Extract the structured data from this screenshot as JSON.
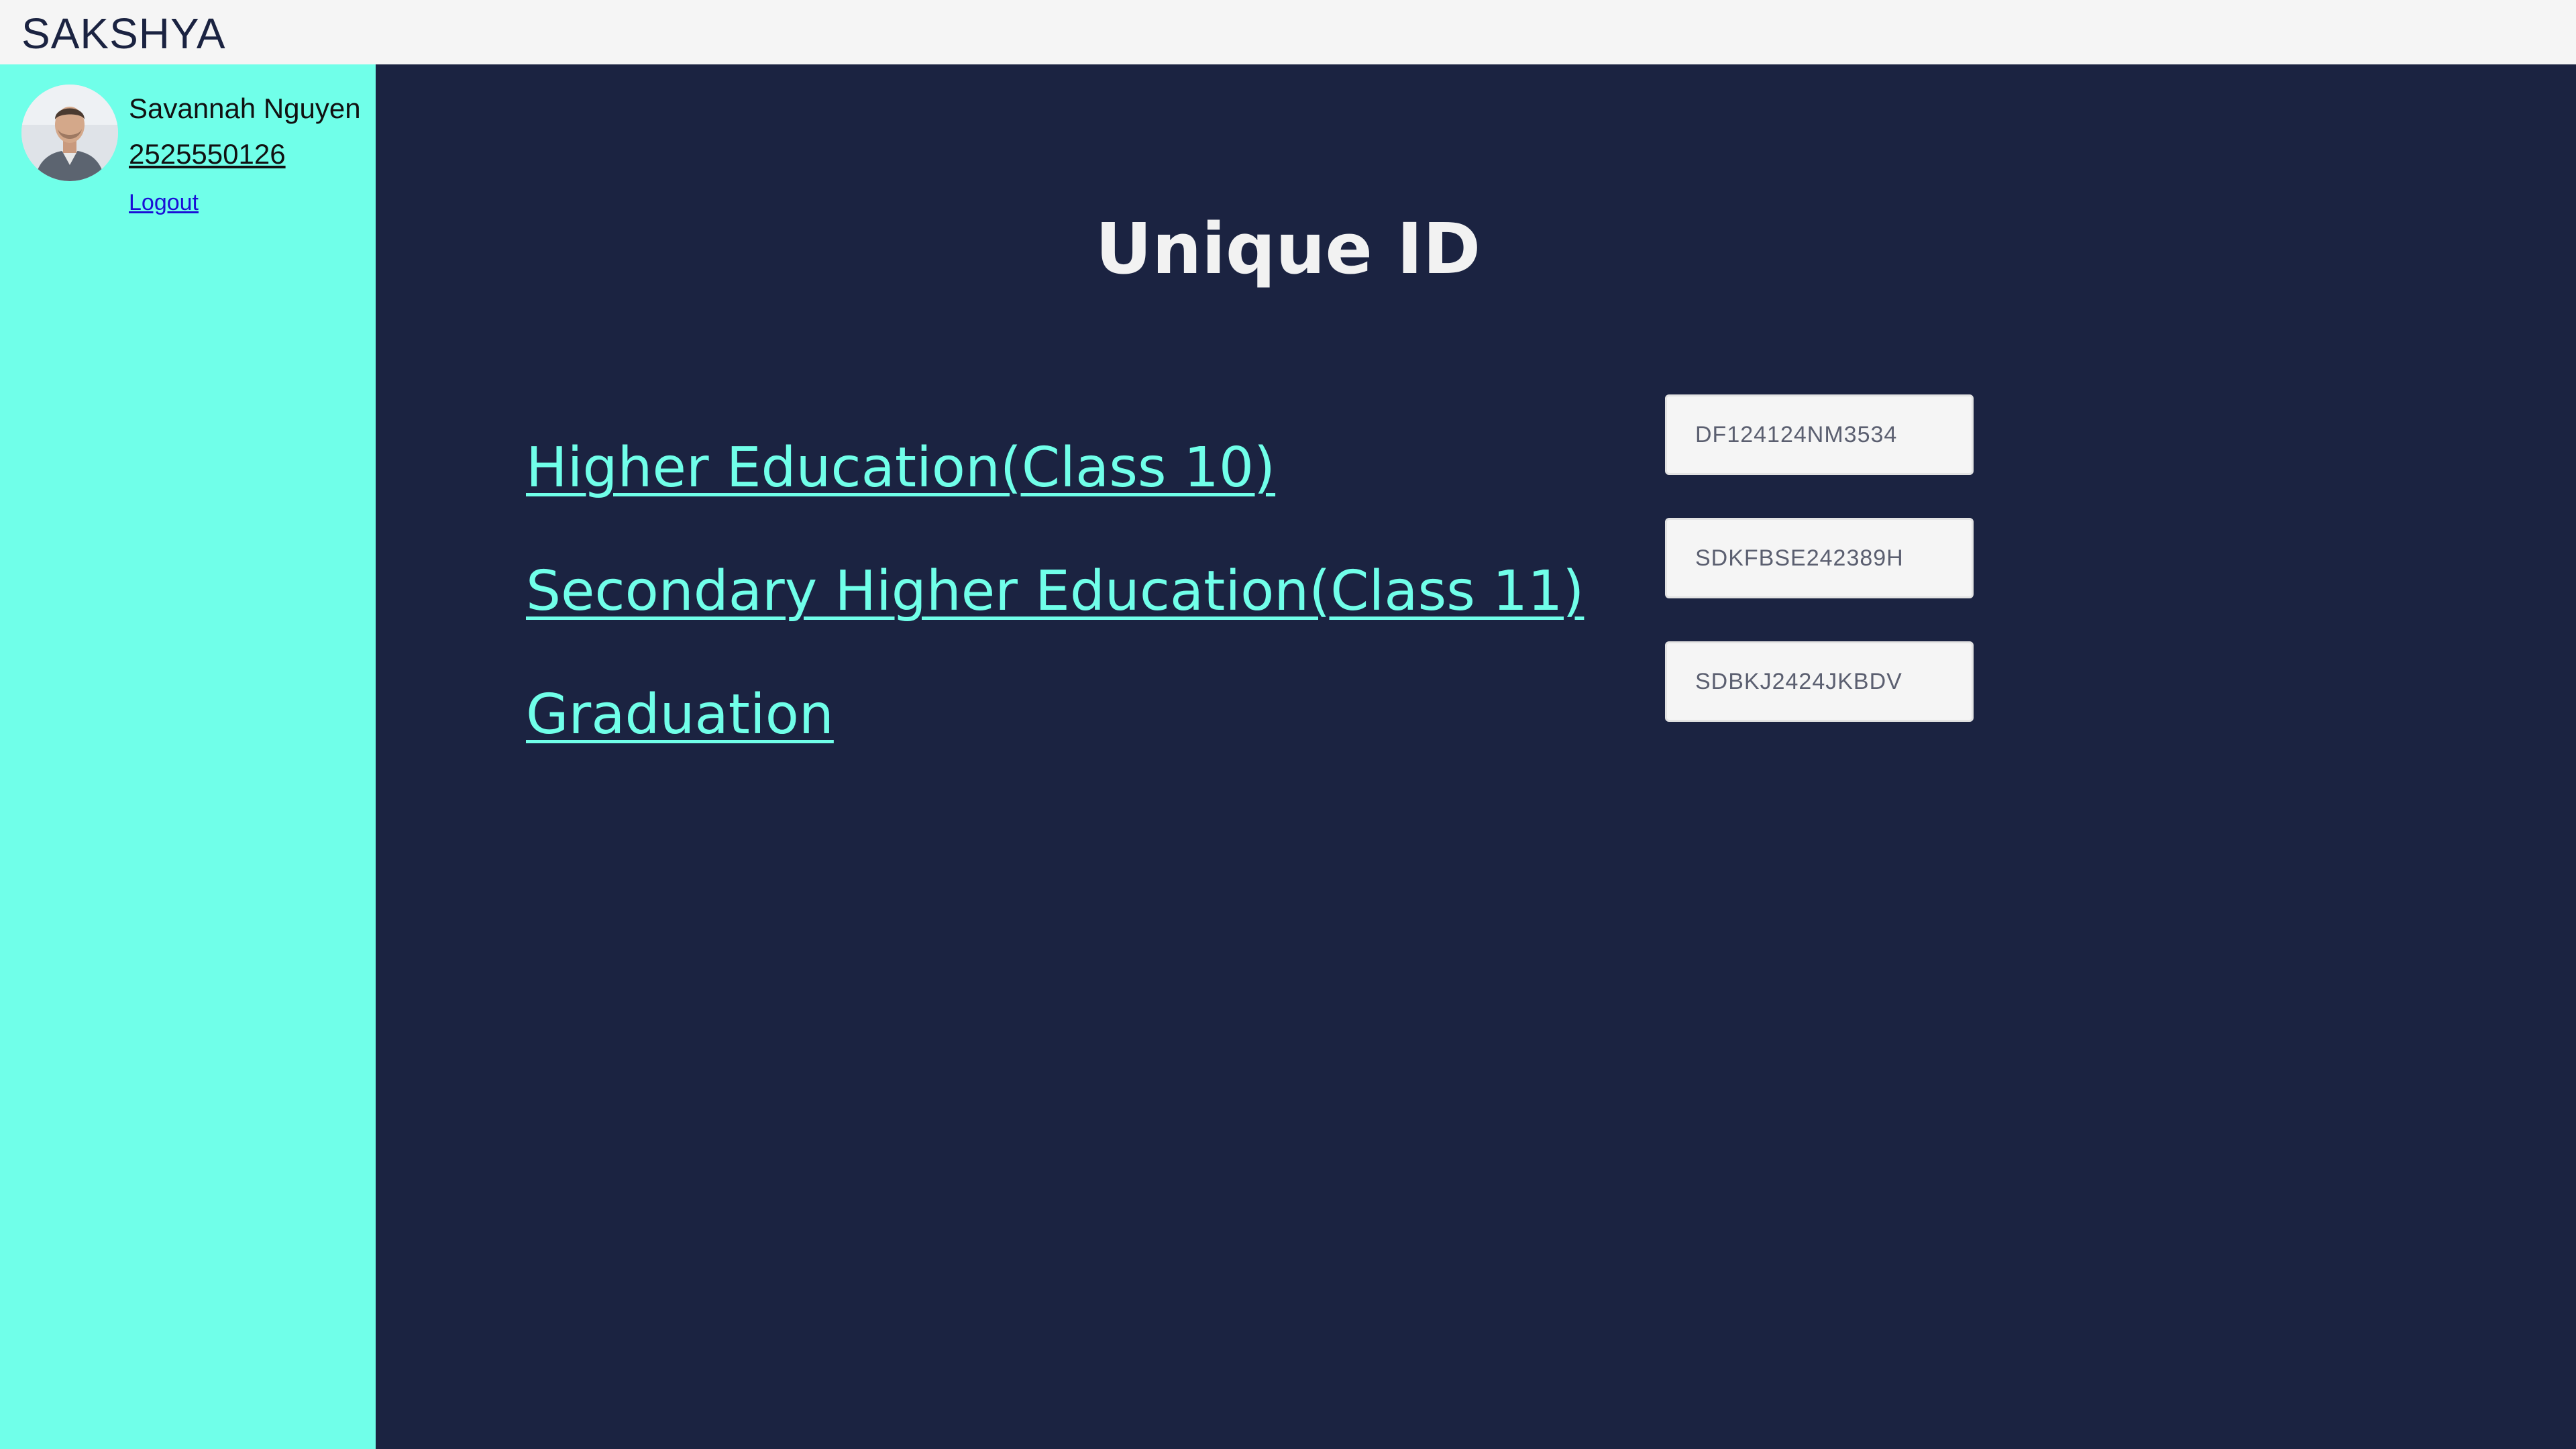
{
  "app": {
    "brand": "SAKSHYA"
  },
  "user": {
    "name": "Savannah Nguyen",
    "phone": "2525550126",
    "logout_label": "Logout",
    "avatar_icon": "user-avatar-icon"
  },
  "main": {
    "title": "Unique ID",
    "rows": [
      {
        "label": "Higher Education(Class 10)",
        "id": "DF124124NM3534"
      },
      {
        "label": "Secondary Higher Education(Class 11)",
        "id": "SDKFBSE242389H"
      },
      {
        "label": "Graduation",
        "id": "SDBKJ2424JKBDV"
      }
    ]
  },
  "colors": {
    "header_bg": "#f5f5f5",
    "sidebar_bg": "#70ffe9",
    "main_bg": "#1b2341",
    "accent": "#70ffe9",
    "logout_link": "#1a0fd6"
  }
}
